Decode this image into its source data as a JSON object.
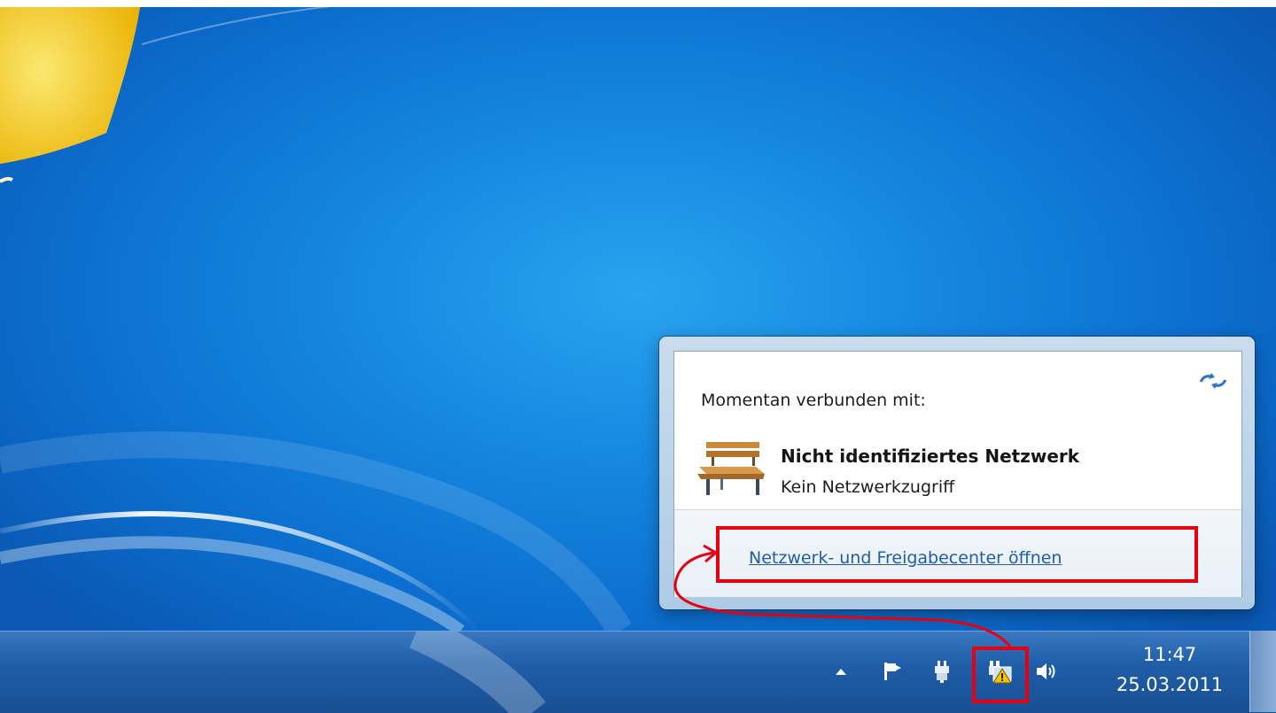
{
  "popup": {
    "header": "Momentan verbunden mit:",
    "network_name": "Nicht identifiziertes Netzwerk",
    "network_status": "Kein Netzwerkzugriff",
    "open_center_link": "Netzwerk- und Freigabecenter öffnen"
  },
  "taskbar": {
    "tray_icons": [
      "show-hidden-icons-icon",
      "action-center-flag-icon",
      "power-plug-icon",
      "network-warning-icon",
      "speaker-icon"
    ],
    "clock_time": "11:47",
    "clock_date": "25.03.2011"
  },
  "colors": {
    "highlight": "#e8000f",
    "link": "#1e5ea8",
    "taskbar": "#1f5ea8"
  }
}
